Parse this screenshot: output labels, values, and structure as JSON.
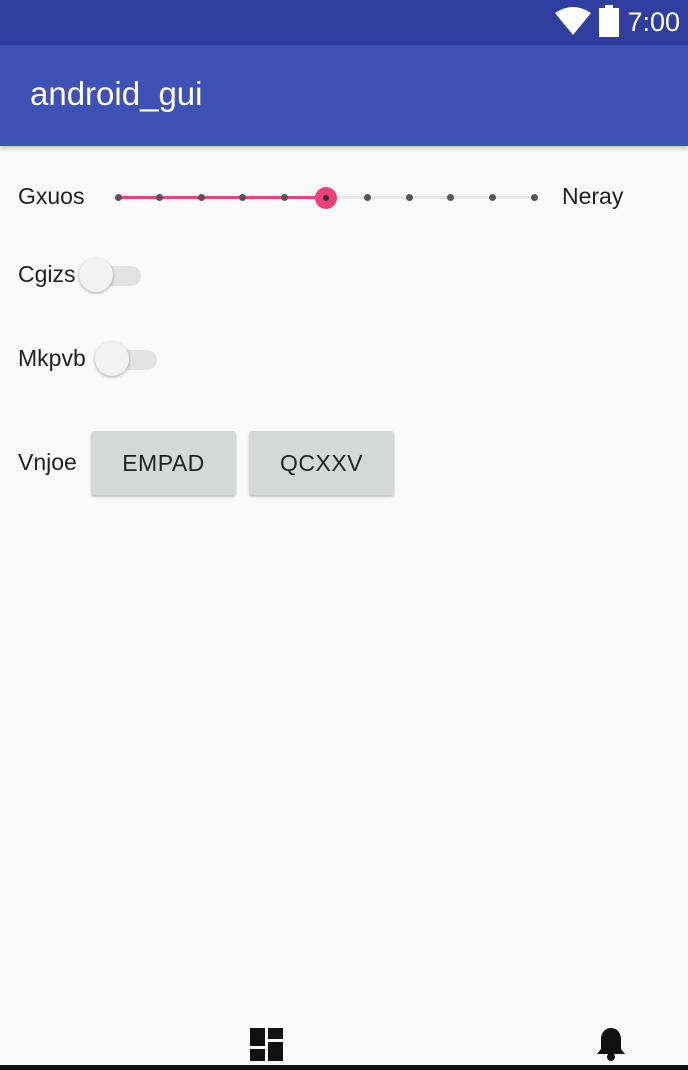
{
  "status_bar": {
    "time": "7:00",
    "icons": [
      "wifi-icon",
      "battery-icon"
    ],
    "background": "#303f9f"
  },
  "app_bar": {
    "title": "android_gui",
    "background": "#3f51b5"
  },
  "slider_row": {
    "left_label": "Gxuos",
    "right_label": "Neray",
    "steps": 10,
    "value": 5,
    "accent": "#f0407a"
  },
  "switches": [
    {
      "label": "Cgizs",
      "checked": false
    },
    {
      "label": "Mkpvb",
      "checked": false
    }
  ],
  "button_row": {
    "label": "Vnjoe",
    "buttons": [
      "EMPAD",
      "QCXXV"
    ]
  },
  "bottom_nav": {
    "items": [
      "dashboard-icon",
      "notification-bell-icon"
    ]
  }
}
